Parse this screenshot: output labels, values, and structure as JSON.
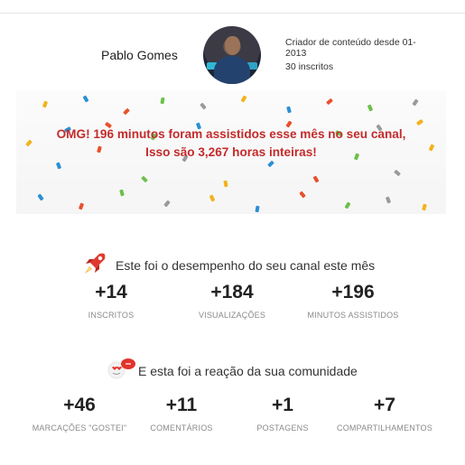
{
  "header": {
    "channel_name": "Pablo Gomes",
    "creator_since": "Criador de conteúdo desde 01-2013",
    "subscribers": "30 inscritos"
  },
  "banner": {
    "line1": "OMG! 196 minutos foram assistidos esse mês no seu canal,",
    "line2": "Isso são 3,267 horas inteiras!"
  },
  "performance": {
    "title": "Este foi o desempenho do seu canal este mês",
    "icon": "rocket-icon",
    "stats": [
      {
        "value": "+14",
        "label": "INSCRITOS"
      },
      {
        "value": "+184",
        "label": "VISUALIZAÇÕES"
      },
      {
        "value": "+196",
        "label": "MINUTOS ASSISTIDOS"
      }
    ]
  },
  "community": {
    "title": "E esta foi a reação da sua comunidade",
    "icon": "love-face-icon",
    "stats": [
      {
        "value": "+46",
        "label": "MARCAÇÕES \"GOSTEI\""
      },
      {
        "value": "+11",
        "label": "COMENTÁRIOS"
      },
      {
        "value": "+1",
        "label": "POSTAGENS"
      },
      {
        "value": "+7",
        "label": "COMPARTILHAMENTOS"
      }
    ]
  },
  "colors": {
    "headline": "#c42b2b",
    "confetti": [
      "#f2b21b",
      "#2a8fd6",
      "#e8502a",
      "#6cc04a",
      "#9a9a9a"
    ]
  }
}
